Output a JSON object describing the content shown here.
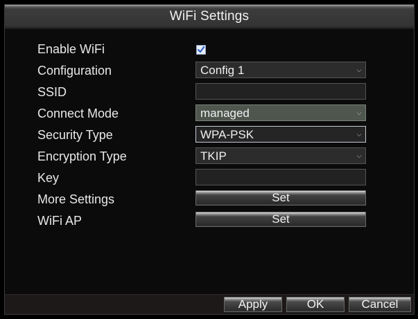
{
  "window": {
    "title": "WiFi Settings"
  },
  "form": {
    "enable_wifi": {
      "label": "Enable WiFi",
      "checked": true
    },
    "configuration": {
      "label": "Configuration",
      "value": "Config 1"
    },
    "ssid": {
      "label": "SSID",
      "value": ""
    },
    "connect_mode": {
      "label": "Connect Mode",
      "value": "managed"
    },
    "security_type": {
      "label": "Security Type",
      "value": "WPA-PSK"
    },
    "encryption_type": {
      "label": "Encryption Type",
      "value": "TKIP"
    },
    "key": {
      "label": "Key",
      "value": ""
    },
    "more_settings": {
      "label": "More Settings",
      "button": "Set"
    },
    "wifi_ap": {
      "label": "WiFi AP",
      "button": "Set"
    }
  },
  "footer": {
    "apply": "Apply",
    "ok": "OK",
    "cancel": "Cancel"
  },
  "icons": {
    "checkbox": "check-icon",
    "dropdown": "chevron-down-icon"
  },
  "colors": {
    "background": "#0b0b0b",
    "highlight": "#4e564e",
    "check": "#2f63c7"
  }
}
